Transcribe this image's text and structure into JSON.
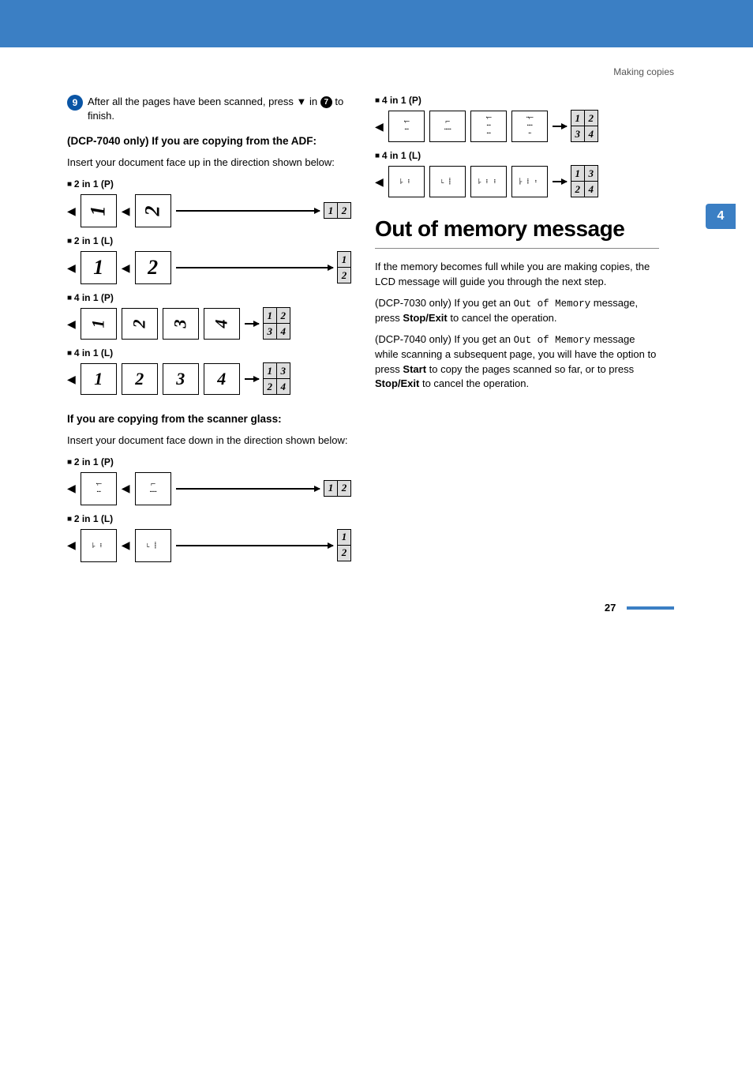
{
  "header_text": "Making copies",
  "side_tab": "4",
  "page_number": "27",
  "left": {
    "step9_num": "9",
    "step9_text_a": "After all the pages have been scanned, press ",
    "down_glyph": "▼",
    "step9_text_b": " in ",
    "bullet_ref": "7",
    "step9_text_c": " to finish.",
    "adf_heading": "(DCP-7040 only) If you are copying from the ADF:",
    "adf_body": "Insert your document face up in the direction shown below:",
    "b1": "2 in 1 (P)",
    "b2": "2 in 1 (L)",
    "b3": "4 in 1 (P)",
    "b4": "4 in 1 (L)",
    "glass_heading": "If you are copying from the scanner glass:",
    "glass_body": "Insert your document face down in the direction shown below:",
    "g1": "2 in 1 (P)",
    "g2": "2 in 1 (L)"
  },
  "right": {
    "g3": "4 in 1 (P)",
    "g4": "4 in 1 (L)",
    "oom_title": "Out of memory message",
    "oom_p1": "If the memory becomes full while you are making copies, the LCD message will guide you through the next step.",
    "oom_p2a": "(DCP-7030 only) If you get an ",
    "oom_mono1": "Out of Memory",
    "oom_p2b": " message, press ",
    "oom_bold1": "Stop/Exit",
    "oom_p2c": " to cancel the operation.",
    "oom_p3a": "(DCP-7040 only) If you get an ",
    "oom_mono2": "Out of Memory",
    "oom_p3b": " message while scanning a subsequent page, you will have the option to press ",
    "oom_bold2": "Start",
    "oom_p3c": " to copy the pages scanned so far, or to press ",
    "oom_bold3": "Stop/Exit",
    "oom_p3d": " to cancel the operation."
  },
  "nums": {
    "n1": "1",
    "n2": "2",
    "n3": "3",
    "n4": "4"
  },
  "chart_data": [
    {
      "type": "table",
      "title": "ADF 2 in 1 (P)",
      "inputs": [
        "1 (rotated)",
        "2 (rotated)"
      ],
      "output_grid": [
        [
          "1",
          "2"
        ]
      ]
    },
    {
      "type": "table",
      "title": "ADF 2 in 1 (L)",
      "inputs": [
        "1",
        "2"
      ],
      "output_grid": [
        [
          "1"
        ],
        [
          "2"
        ]
      ]
    },
    {
      "type": "table",
      "title": "ADF 4 in 1 (P)",
      "inputs": [
        "1 (rotated)",
        "2 (rotated)",
        "3 (rotated)",
        "4 (rotated)"
      ],
      "output_grid": [
        [
          "1",
          "2"
        ],
        [
          "3",
          "4"
        ]
      ]
    },
    {
      "type": "table",
      "title": "ADF 4 in 1 (L)",
      "inputs": [
        "1",
        "2",
        "3",
        "4"
      ],
      "output_grid": [
        [
          "1",
          "3"
        ],
        [
          "2",
          "4"
        ]
      ]
    },
    {
      "type": "table",
      "title": "Glass 2 in 1 (P)",
      "inputs": [
        "1 (dots)",
        "2 (dots)"
      ],
      "output_grid": [
        [
          "1",
          "2"
        ]
      ]
    },
    {
      "type": "table",
      "title": "Glass 2 in 1 (L)",
      "inputs": [
        "1 (dots rotated)",
        "2 (dots rotated)"
      ],
      "output_grid": [
        [
          "1"
        ],
        [
          "2"
        ]
      ]
    },
    {
      "type": "table",
      "title": "Glass 4 in 1 (P)",
      "inputs": [
        "1",
        "2",
        "3",
        "4"
      ],
      "output_grid": [
        [
          "1",
          "2"
        ],
        [
          "3",
          "4"
        ]
      ]
    },
    {
      "type": "table",
      "title": "Glass 4 in 1 (L)",
      "inputs": [
        "1 (rotated)",
        "2 (rotated)",
        "3 (rotated)",
        "4 (rotated)"
      ],
      "output_grid": [
        [
          "1",
          "3"
        ],
        [
          "2",
          "4"
        ]
      ]
    }
  ]
}
